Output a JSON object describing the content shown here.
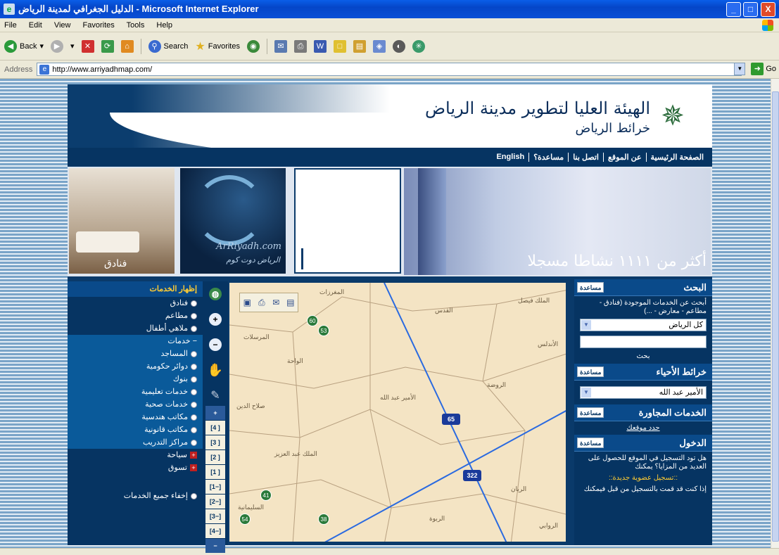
{
  "window": {
    "title": "الدليل الجغرافي لمدينة الرياض - Microsoft Internet Explorer",
    "controls": [
      "_",
      "□",
      "X"
    ]
  },
  "menu": [
    "File",
    "Edit",
    "View",
    "Favorites",
    "Tools",
    "Help"
  ],
  "toolbar": {
    "back": "Back",
    "search": "Search",
    "favorites": "Favorites"
  },
  "address": {
    "label": "Address",
    "url": "http://www.arriyadhmap.com/",
    "go": "Go"
  },
  "site": {
    "title": "الهيئة العليا لتطوير مدينة الرياض",
    "subtitle": "خرائط الرياض",
    "emblem_icon": "saudi-emblem-icon",
    "nav": [
      "الصفحة الرئيسية",
      "عن الموقع",
      "اتصل بنا",
      "مساعدة؟",
      "English"
    ],
    "banner": {
      "hotels_label": "فنادق",
      "arriyadh_en": "ArRiyadh.com",
      "arriyadh_ar": "الرياض دوت كوم",
      "count_text": "أكثر من ١١١١ نشاطا مسجلا"
    }
  },
  "right_panel": {
    "search": {
      "title": "البحث",
      "help": "مساعدة",
      "desc": "أبحث عن الخدمات الموجودة (فنادق - مطاعم - معارض - ...)",
      "select_value": "كل الرياض",
      "button": "بحث"
    },
    "districts": {
      "title": "خرائط الأحياء",
      "help": "مساعدة",
      "select_value": "الأمير عبد الله"
    },
    "nearby": {
      "title": "الخدمات المجاورة",
      "help": "مساعدة",
      "link": "حدد موقعك"
    },
    "login": {
      "title": "الدخول",
      "help": "مساعدة",
      "desc": "هل تود التسجيل في الموقع للحصول على العديد من المزايا؟ يمكنك",
      "register": "::تسجيل عضوية جديدة::",
      "already": "إذا كنت قد قمت بالتسجيل من قبل فيمكنك"
    }
  },
  "left_panel": {
    "header": "إظهار الخدمات",
    "items": [
      {
        "label": "فنادق",
        "type": "radio"
      },
      {
        "label": "مطاعم",
        "type": "radio"
      },
      {
        "label": "ملاهي أطفال",
        "type": "radio"
      }
    ],
    "sub_header": "− خدمات",
    "sub_items": [
      {
        "label": "المساجد",
        "type": "radio"
      },
      {
        "label": "دوائر حكومية",
        "type": "radio"
      },
      {
        "label": "بنوك",
        "type": "radio"
      },
      {
        "label": "خدمات تعليمية",
        "type": "radio"
      },
      {
        "label": "خدمات صحية",
        "type": "radio"
      },
      {
        "label": "مكاتب هندسية",
        "type": "radio"
      },
      {
        "label": "مكاتب قانونية",
        "type": "radio"
      },
      {
        "label": "مراكز التدريب",
        "type": "radio"
      }
    ],
    "expand_items": [
      {
        "label": "سياحة"
      },
      {
        "label": "تسوق"
      }
    ],
    "hide_all": "إخفاء جميع الخدمات"
  },
  "map_tools": {
    "zoom_levels": [
      "+",
      "[4 ]",
      "[3 ]",
      "[2 ]",
      "[1 ]",
      "[1−]",
      "[2−]",
      "[3−]",
      "[4−]",
      "−"
    ]
  },
  "map": {
    "labels": [
      "المغرزات",
      "الملك فيصل",
      "القدس",
      "الأندلس",
      "المرسلات",
      "الواحة",
      "الروضة",
      "الأمير عبد الله",
      "صلاح الدين",
      "الملك عبد العزيز",
      "الريان",
      "السليمانية",
      "الربوة",
      "الروابي"
    ],
    "pois": [
      "60",
      "53",
      "41",
      "54",
      "38"
    ],
    "roads": [
      "65",
      "322"
    ]
  },
  "colors": {
    "title_bar": "#0a4fd6",
    "site_navy": "#063462",
    "map_bg": "#f4e4c4",
    "road_line": "#2a6ae0"
  }
}
